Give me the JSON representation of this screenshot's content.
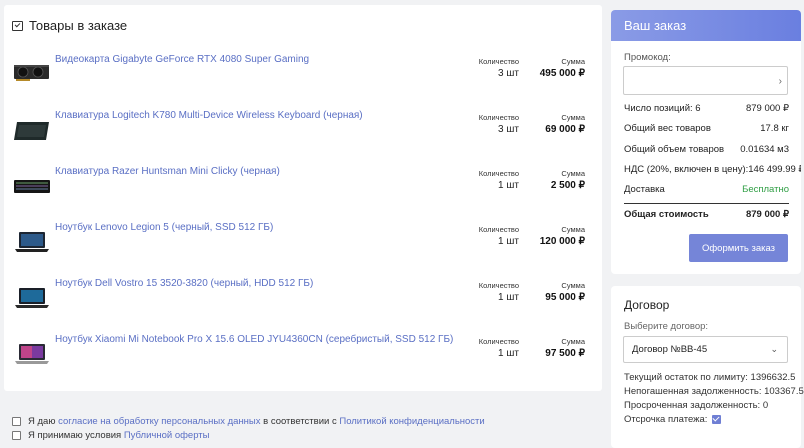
{
  "cart": {
    "title": "Товары в заказе",
    "qty_label": "Количество",
    "sum_label": "Сумма",
    "items": [
      {
        "name": "Видеокарта Gigabyte GeForce RTX 4080 Super Gaming",
        "qty": "3 шт",
        "sum": "495 000 ₽",
        "icon": "gpu-icon"
      },
      {
        "name": "Клавиатура Logitech K780 Multi-Device Wireless Keyboard (черная)",
        "qty": "3 шт",
        "sum": "69 000 ₽",
        "icon": "keyboard-icon"
      },
      {
        "name": "Клавиатура Razer Huntsman Mini Clicky (черная)",
        "qty": "1 шт",
        "sum": "2 500 ₽",
        "icon": "keyboard-icon"
      },
      {
        "name": "Ноутбук Lenovo Legion 5 (черный, SSD 512 ГБ)",
        "qty": "1 шт",
        "sum": "120 000 ₽",
        "icon": "laptop-icon"
      },
      {
        "name": "Ноутбук Dell Vostro 15 3520-3820 (черный, HDD 512 ГБ)",
        "qty": "1 шт",
        "sum": "95 000 ₽",
        "icon": "laptop-icon"
      },
      {
        "name": "Ноутбук Xiaomi Mi Notebook Pro X 15.6 OLED JYU4360CN (серебристый, SSD 512 ГБ)",
        "qty": "1 шт",
        "sum": "97 500 ₽",
        "icon": "laptop-icon"
      }
    ]
  },
  "consents": {
    "c1_pre": "Я даю ",
    "c1_link1": "согласие на обработку персональных данных",
    "c1_mid": " в соответствии с ",
    "c1_link2": "Политикой конфиденциальности",
    "c2_pre": "Я принимаю условия ",
    "c2_link": "Публичной оферты"
  },
  "order": {
    "title": "Ваш заказ",
    "promo_label": "Промокод:",
    "promo_value": "",
    "rows": [
      {
        "label": "Число позиций: 6",
        "value": "879 000 ₽"
      },
      {
        "label": "Общий вес товаров",
        "value": "17.8 кг"
      },
      {
        "label": "Общий объем товаров",
        "value": "0.01634 м3"
      },
      {
        "label": "НДС (20%, включен в цену):",
        "value": "146 499.99 ₽"
      },
      {
        "label": "Доставка",
        "value": "Бесплатно"
      }
    ],
    "total_label": "Общая стоимость",
    "total_value": "879 000 ₽",
    "button": "Оформить заказ",
    "free_color": "#2f9e44",
    "accent_color": "#7585d8"
  },
  "contract": {
    "title": "Договор",
    "select_label": "Выберите договор:",
    "selected": "Договор №ВВ-45",
    "limit": "Текущий остаток по лимиту: 1396632.5",
    "debt": "Непогашенная задолженность: 103367.5",
    "overdue": "Просроченная задолженность: 0",
    "deferral": "Отсрочка платежа:",
    "deferral_checked": true
  }
}
